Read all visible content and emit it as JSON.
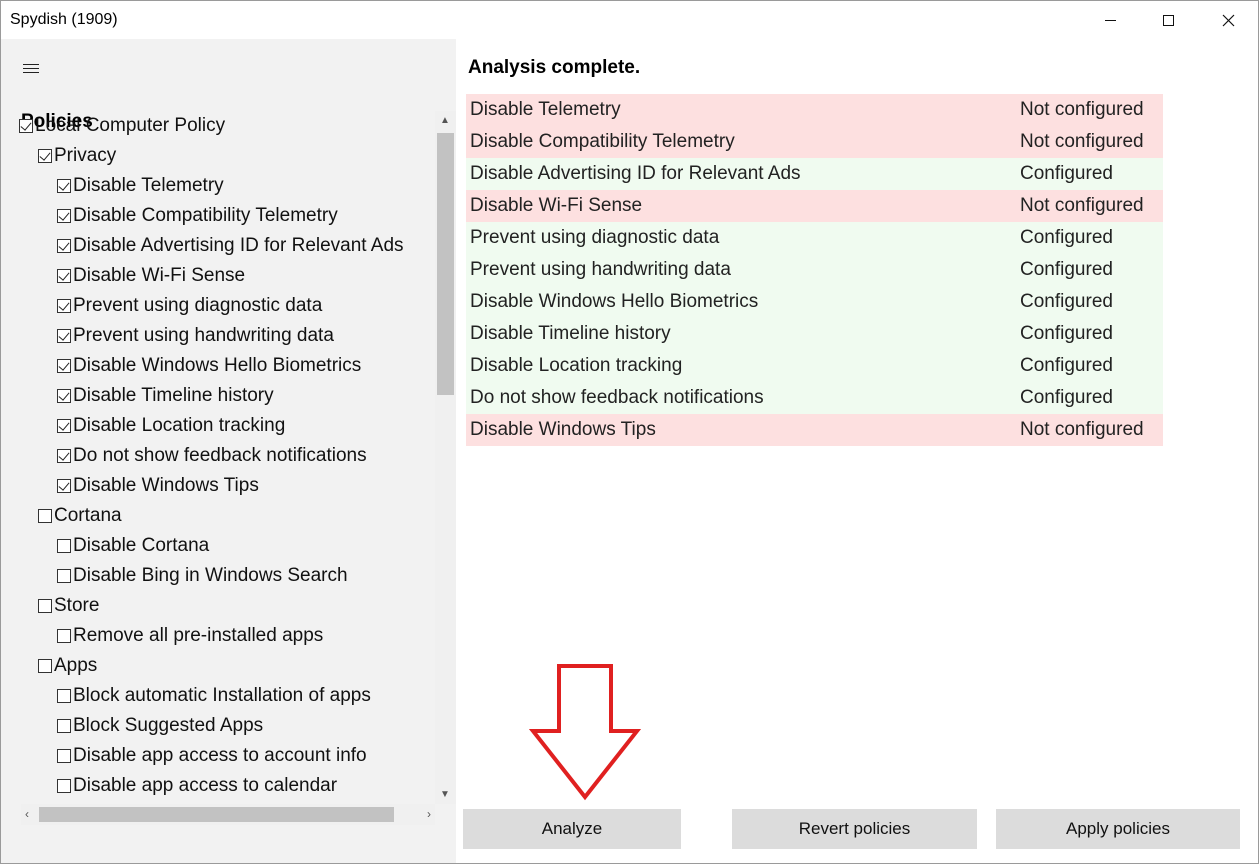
{
  "window": {
    "title": "Spydish (1909)"
  },
  "sidebar": {
    "menu_icon": "hamburger-icon",
    "title": "Policies",
    "tree": [
      {
        "label": "Local Computer Policy",
        "level": 0,
        "checked": true
      },
      {
        "label": "Privacy",
        "level": 1,
        "checked": true
      },
      {
        "label": "Disable Telemetry",
        "level": 2,
        "checked": true
      },
      {
        "label": "Disable Compatibility Telemetry",
        "level": 2,
        "checked": true
      },
      {
        "label": "Disable Advertising ID for Relevant Ads",
        "level": 2,
        "checked": true
      },
      {
        "label": "Disable Wi-Fi Sense",
        "level": 2,
        "checked": true
      },
      {
        "label": "Prevent using diagnostic data",
        "level": 2,
        "checked": true
      },
      {
        "label": "Prevent using handwriting data",
        "level": 2,
        "checked": true
      },
      {
        "label": "Disable Windows Hello Biometrics",
        "level": 2,
        "checked": true
      },
      {
        "label": "Disable Timeline history",
        "level": 2,
        "checked": true
      },
      {
        "label": "Disable Location tracking",
        "level": 2,
        "checked": true
      },
      {
        "label": "Do not show feedback notifications",
        "level": 2,
        "checked": true
      },
      {
        "label": "Disable Windows Tips",
        "level": 2,
        "checked": true
      },
      {
        "label": "Cortana",
        "level": 1,
        "checked": false
      },
      {
        "label": "Disable Cortana",
        "level": 2,
        "checked": false
      },
      {
        "label": "Disable Bing in Windows Search",
        "level": 2,
        "checked": false
      },
      {
        "label": "Store",
        "level": 1,
        "checked": false
      },
      {
        "label": "Remove all pre-installed apps",
        "level": 2,
        "checked": false
      },
      {
        "label": "Apps",
        "level": 1,
        "checked": false
      },
      {
        "label": "Block automatic Installation of apps",
        "level": 2,
        "checked": false
      },
      {
        "label": "Block Suggested Apps",
        "level": 2,
        "checked": false
      },
      {
        "label": "Disable app access to account info",
        "level": 2,
        "checked": false
      },
      {
        "label": "Disable app access to calendar",
        "level": 2,
        "checked": false
      }
    ]
  },
  "main": {
    "status": "Analysis complete.",
    "results": [
      {
        "name": "Disable Telemetry",
        "state": "Not configured",
        "ok": false
      },
      {
        "name": "Disable Compatibility Telemetry",
        "state": "Not configured",
        "ok": false
      },
      {
        "name": "Disable Advertising ID for Relevant Ads",
        "state": "Configured",
        "ok": true
      },
      {
        "name": "Disable Wi-Fi Sense",
        "state": "Not configured",
        "ok": false
      },
      {
        "name": "Prevent using diagnostic data",
        "state": "Configured",
        "ok": true
      },
      {
        "name": "Prevent using handwriting data",
        "state": "Configured",
        "ok": true
      },
      {
        "name": "Disable Windows Hello Biometrics",
        "state": "Configured",
        "ok": true
      },
      {
        "name": "Disable Timeline history",
        "state": "Configured",
        "ok": true
      },
      {
        "name": "Disable Location tracking",
        "state": "Configured",
        "ok": true
      },
      {
        "name": "Do not show feedback notifications",
        "state": "Configured",
        "ok": true
      },
      {
        "name": "Disable Windows Tips",
        "state": "Not configured",
        "ok": false
      }
    ]
  },
  "buttons": {
    "analyze": "Analyze",
    "revert": "Revert policies",
    "apply": "Apply policies"
  },
  "colors": {
    "not_configured_bg": "#fde0e0",
    "configured_bg": "#f0fbf0",
    "callout_arrow": "#e02020",
    "button_bg": "#dcdcdc",
    "sidebar_bg": "#f2f2f2"
  }
}
